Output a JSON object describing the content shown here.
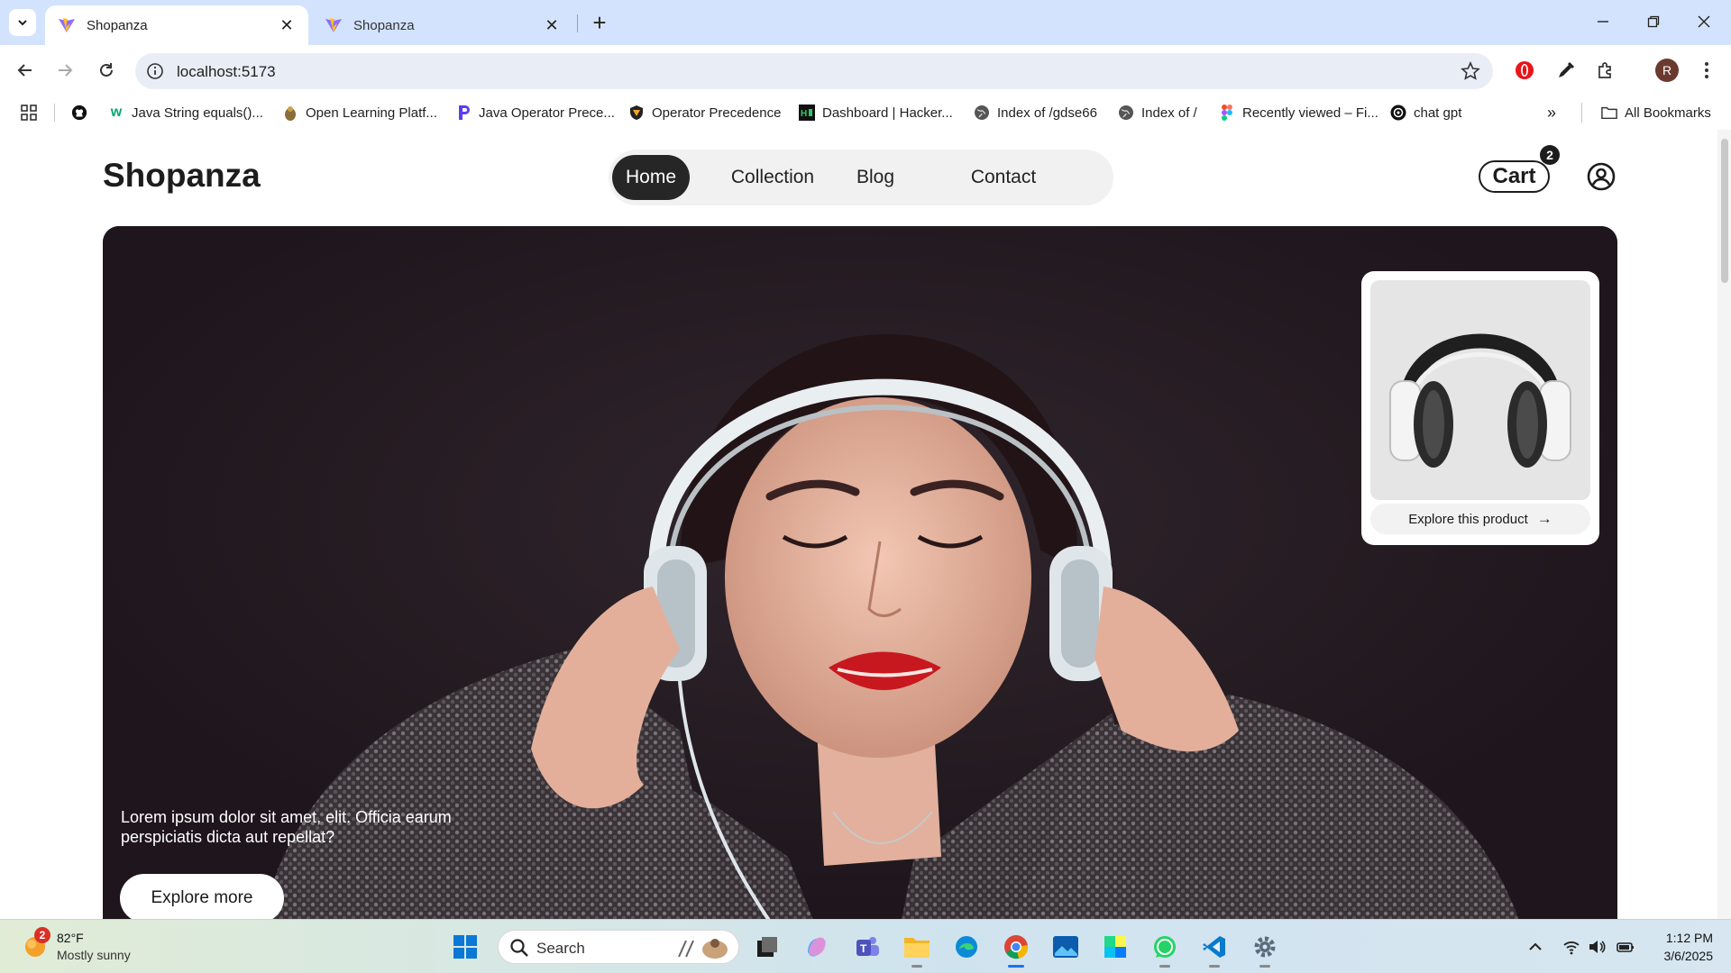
{
  "browser": {
    "tabs": [
      {
        "title": "Shopanza",
        "active": true
      },
      {
        "title": "Shopanza",
        "active": false
      }
    ],
    "address": "localhost:5173",
    "profile_initial": "R",
    "bookmarks": [
      {
        "label": "",
        "icon": "github-icon"
      },
      {
        "label": "Java String equals()...",
        "icon": "w3schools-icon"
      },
      {
        "label": "Open Learning Platf...",
        "icon": "open-learning-icon"
      },
      {
        "label": "Java Operator Prece...",
        "icon": "java-operator-icon"
      },
      {
        "label": "Operator Precedence",
        "icon": "shield-icon"
      },
      {
        "label": "Dashboard | Hacker...",
        "icon": "hackerrank-icon"
      },
      {
        "label": "Index of /gdse66",
        "icon": "globe-icon"
      },
      {
        "label": "Index of /",
        "icon": "globe-icon"
      },
      {
        "label": "Recently viewed – Fi...",
        "icon": "figma-icon"
      },
      {
        "label": "chat gpt",
        "icon": "chatgpt-icon"
      }
    ],
    "all_bookmarks_label": "All Bookmarks"
  },
  "site": {
    "brand": "Shopanza",
    "nav": [
      {
        "label": "Home",
        "active": true
      },
      {
        "label": "Collection",
        "active": false
      },
      {
        "label": "Blog",
        "active": false
      },
      {
        "label": "Contact",
        "active": false
      }
    ],
    "cart_label": "Cart",
    "cart_count": "2",
    "hero": {
      "text": "Lorem ipsum dolor sit amet, elit. Officia earum perspiciatis dicta aut repellat?",
      "button": "Explore more"
    },
    "product_card": {
      "cta": "Explore this product",
      "arrow": "→"
    }
  },
  "taskbar": {
    "weather": {
      "temp": "82°F",
      "desc": "Mostly sunny",
      "badge": "2"
    },
    "search_label": "Search",
    "time": "1:12 PM",
    "date": "3/6/2025"
  },
  "colors": {
    "tabstrip": "#d3e3fd",
    "nav_active": "#262626",
    "hero_bg": "#22191f"
  }
}
